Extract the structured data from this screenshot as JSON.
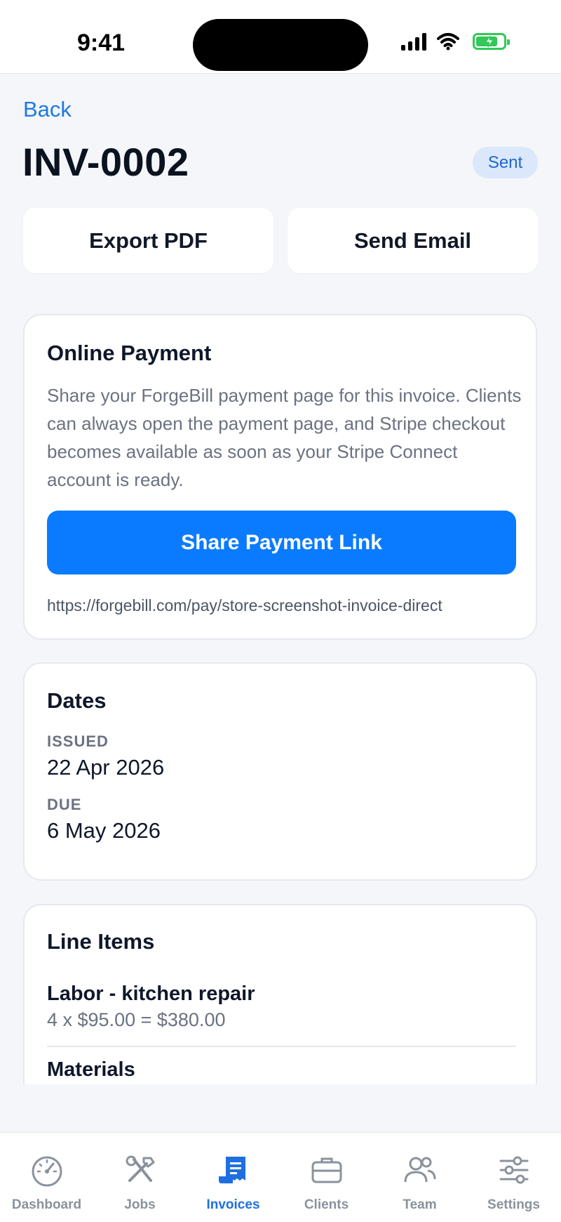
{
  "status_bar": {
    "time": "9:41"
  },
  "nav": {
    "back_label": "Back"
  },
  "invoice": {
    "number": "INV-0002",
    "status": "Sent"
  },
  "actions": {
    "export_label": "Export PDF",
    "email_label": "Send Email"
  },
  "online_payment": {
    "title": "Online Payment",
    "description": "Share your ForgeBill payment page for this invoice. Clients can always open the payment page, and Stripe checkout becomes available as soon as your Stripe Connect account is ready.",
    "button_label": "Share Payment Link",
    "link": "https://forgebill.com/pay/store-screenshot-invoice-direct"
  },
  "dates": {
    "title": "Dates",
    "issued_label": "ISSUED",
    "issued_value": "22 Apr 2026",
    "due_label": "DUE",
    "due_value": "6 May 2026"
  },
  "line_items": {
    "title": "Line Items",
    "items": [
      {
        "name": "Labor - kitchen repair",
        "detail": "4 x $95.00 = $380.00"
      },
      {
        "name": "Materials",
        "detail": ""
      }
    ]
  },
  "tabs": [
    {
      "label": "Dashboard",
      "icon": "gauge-icon"
    },
    {
      "label": "Jobs",
      "icon": "tools-icon"
    },
    {
      "label": "Invoices",
      "icon": "invoice-icon",
      "active": true
    },
    {
      "label": "Clients",
      "icon": "briefcase-icon"
    },
    {
      "label": "Team",
      "icon": "people-icon"
    },
    {
      "label": "Settings",
      "icon": "sliders-icon"
    }
  ],
  "colors": {
    "accent": "#0a7bff",
    "background": "#f4f6f9",
    "badge_bg": "#dbe8fb",
    "tab_inactive": "#8a929c"
  }
}
